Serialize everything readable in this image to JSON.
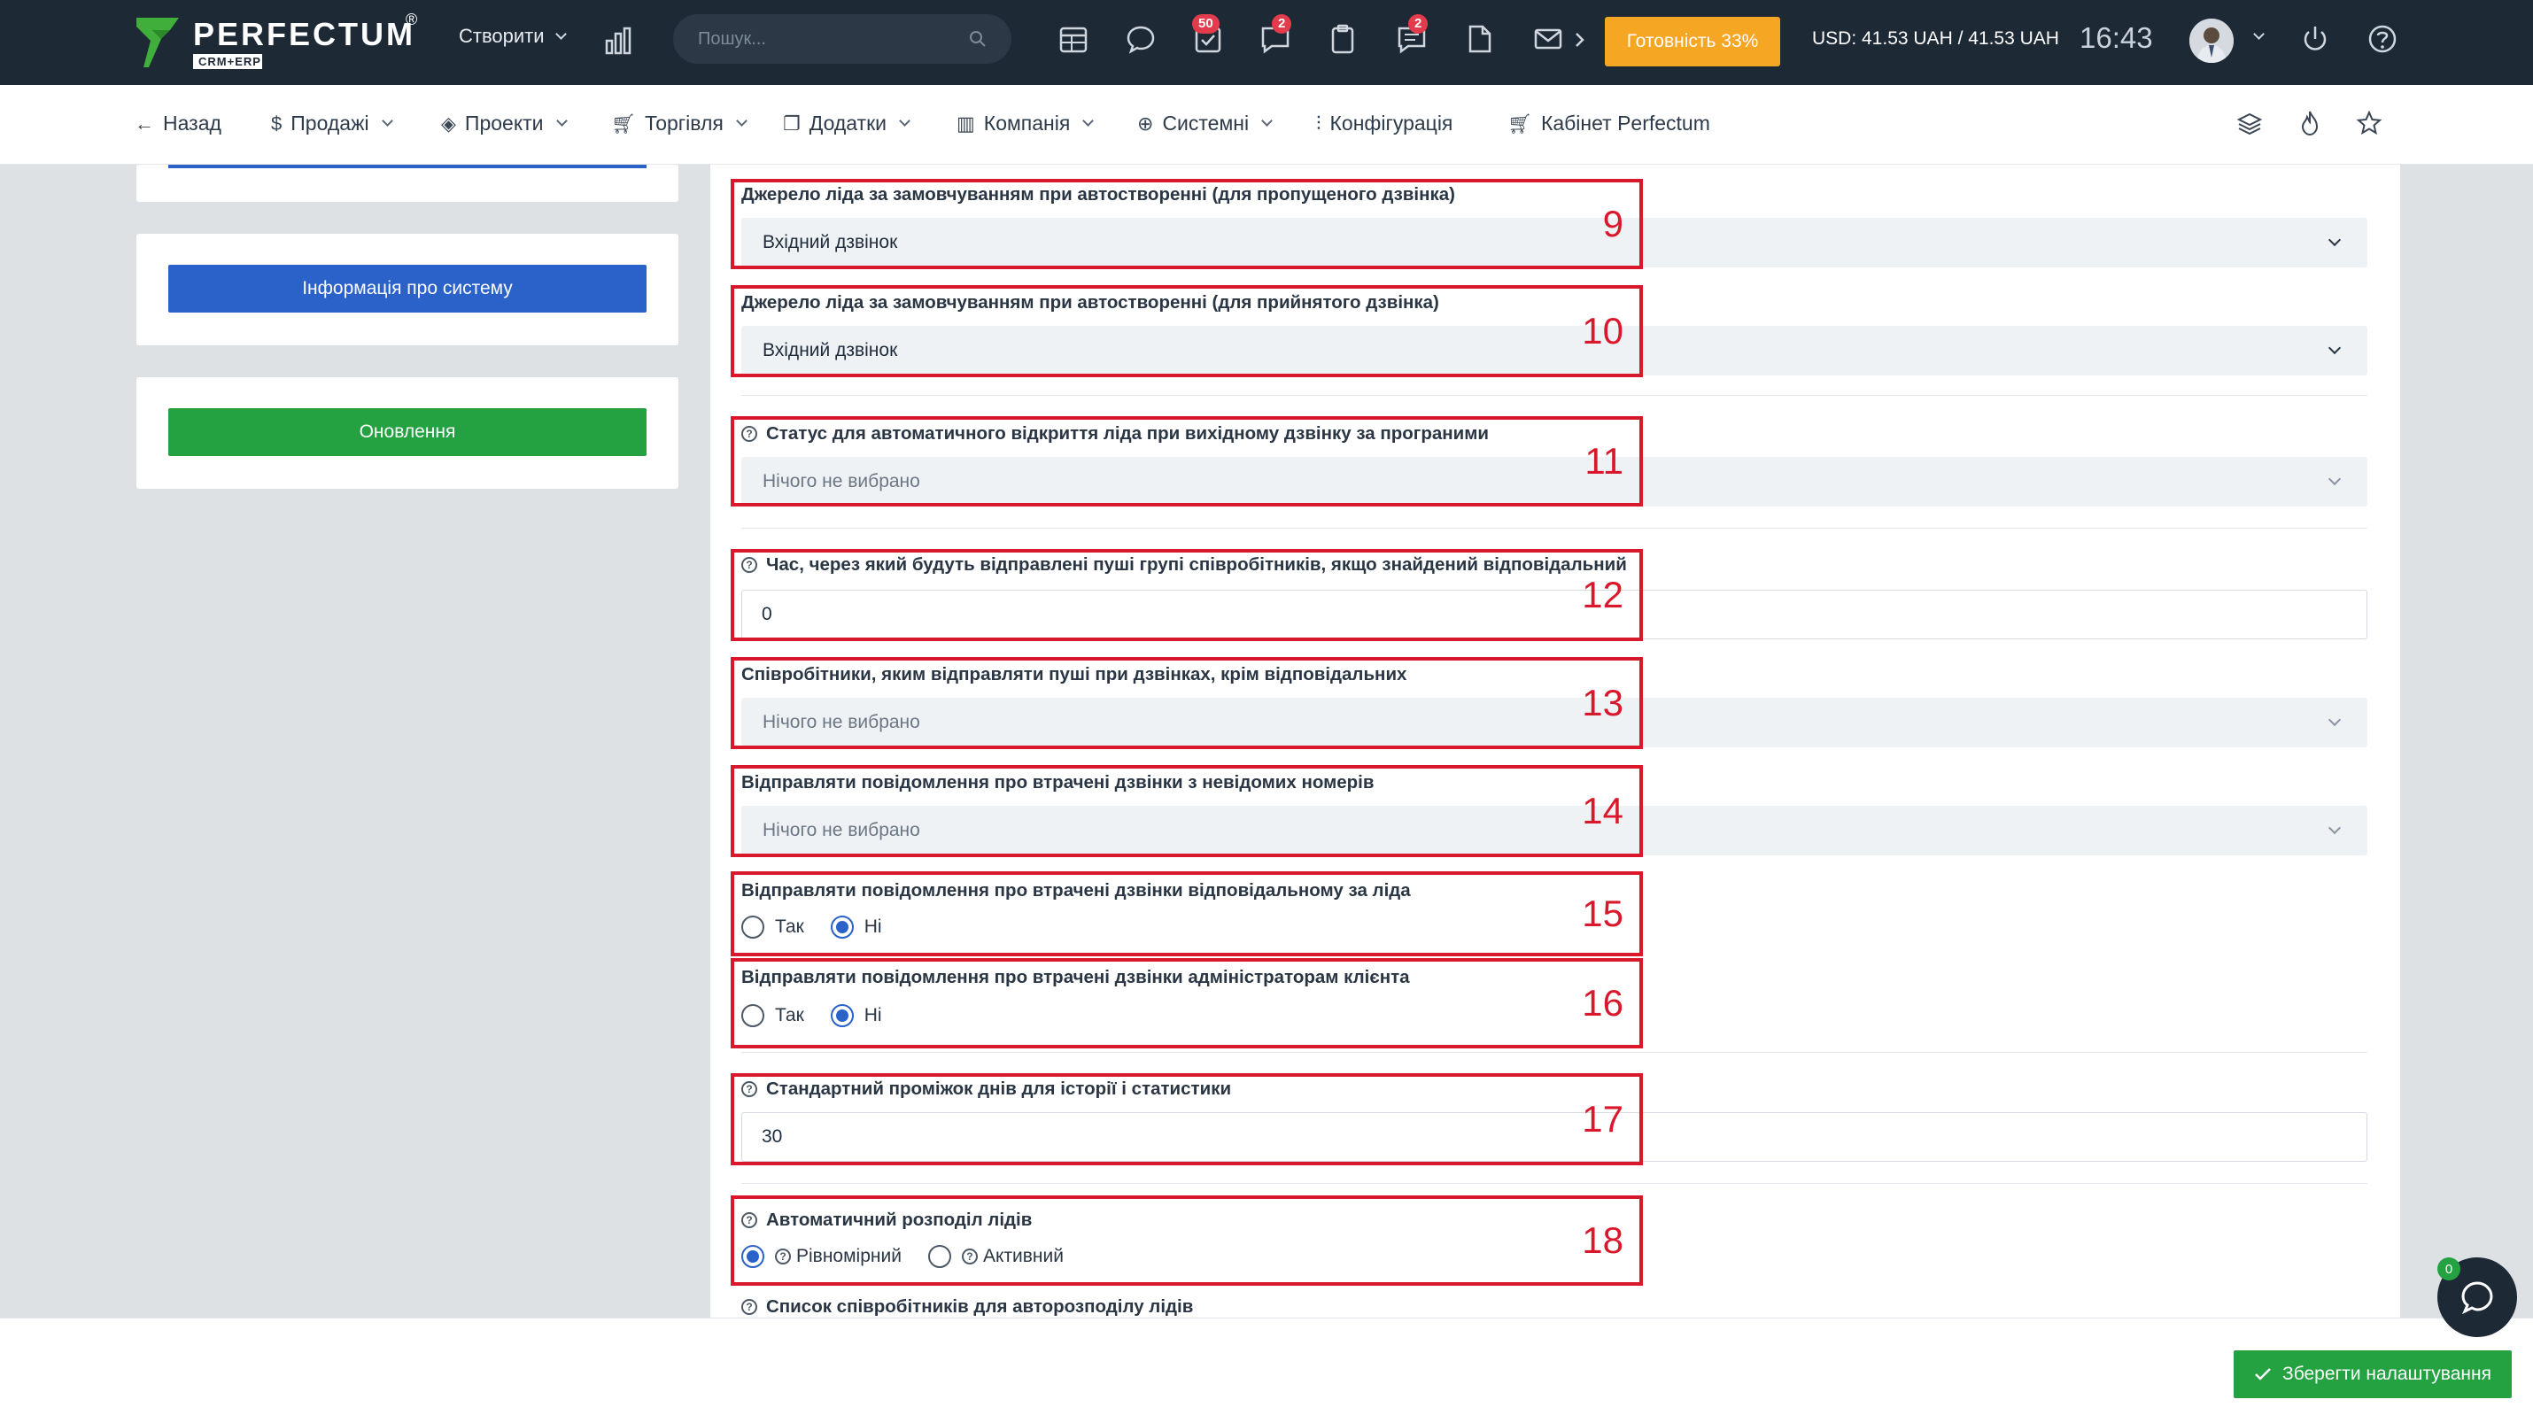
{
  "topbar": {
    "logo_text": "PERFECTUM",
    "logo_reg": "®",
    "logo_sub": "CRM+ERP",
    "create_label": "Створити",
    "search_placeholder": "Пошук...",
    "badges": {
      "tasks": "50",
      "chat": "2",
      "messages": "2"
    },
    "readiness_label": "Готовність 33%",
    "currency": "USD: 41.53 UAH / 41.53 UAH",
    "time": "16:43"
  },
  "nav": {
    "back": "Назад",
    "sales": "Продажі",
    "projects": "Проекти",
    "trade": "Торгівля",
    "addons": "Додатки",
    "company": "Компанія",
    "system": "Системні",
    "config": "Конфігурація",
    "cabinet": "Кабінет Perfectum"
  },
  "sidebar": {
    "system_info_button": "Інформація про систему",
    "updates_button": "Оновлення"
  },
  "fields": {
    "f9": {
      "label": "Джерело ліда за замовчуванням при автостворенні (для пропущеного дзвінка)",
      "value": "Вхідний дзвінок",
      "num": "9"
    },
    "f10": {
      "label": "Джерело ліда за замовчуванням при автостворенні (для прийнятого дзвінка)",
      "value": "Вхідний дзвінок",
      "num": "10"
    },
    "f11": {
      "label": "Статус для автоматичного відкриття ліда при вихідному дзвінку за програними",
      "value": "Нічого не вибрано",
      "num": "11"
    },
    "f12": {
      "label": "Час, через який будуть відправлені пуші групі співробітників, якщо знайдений відповідальний",
      "value": "0",
      "num": "12"
    },
    "f13": {
      "label": "Співробітники, яким відправляти пуші при дзвінках, крім відповідальних",
      "value": "Нічого не вибрано",
      "num": "13"
    },
    "f14": {
      "label": "Відправляти повідомлення про втрачені дзвінки з невідомих номерів",
      "value": "Нічого не вибрано",
      "num": "14"
    },
    "f15": {
      "label": "Відправляти повідомлення про втрачені дзвінки відповідальному за ліда",
      "yes": "Так",
      "no": "Ні",
      "num": "15"
    },
    "f16": {
      "label": "Відправляти повідомлення про втрачені дзвінки адміністраторам клієнта",
      "yes": "Так",
      "no": "Ні",
      "num": "16"
    },
    "f17": {
      "label": "Стандартний проміжок днів для історії і статистики",
      "value": "30",
      "num": "17"
    },
    "f18": {
      "label": "Автоматичний розподіл лідів",
      "opt1": "Рівномірний",
      "opt2": "Активний",
      "num": "18"
    },
    "f19": {
      "label": "Список співробітників для авторозподілу лідів"
    }
  },
  "footer": {
    "save_button": "Зберегти налаштування",
    "chat_badge": "0"
  },
  "colors": {
    "topbar": "#1e2936",
    "accent_blue": "#2a62c9",
    "accent_green": "#24a242",
    "annotation_red": "#d9182c",
    "readiness_orange": "#f5a623"
  }
}
